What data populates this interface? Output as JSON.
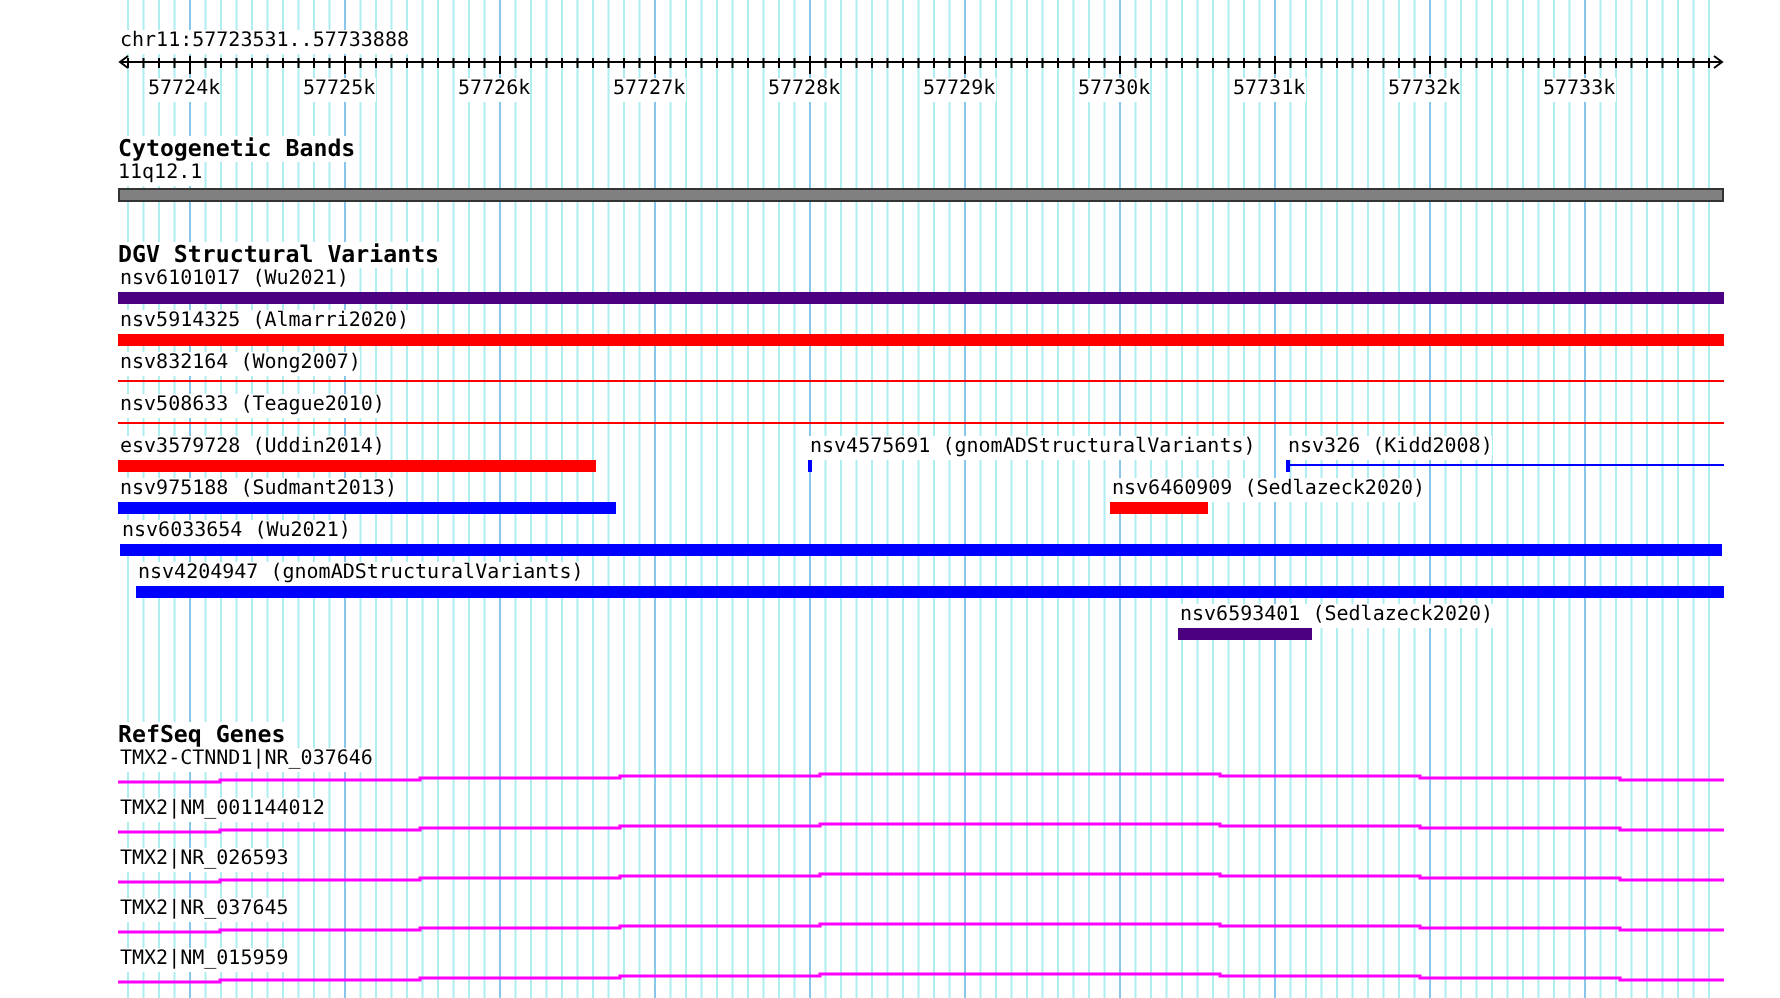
{
  "location": "chr11:57723531..57733888",
  "ruler": {
    "ticks": [
      "57724k",
      "57725k",
      "57726k",
      "57727k",
      "57728k",
      "57729k",
      "57730k",
      "57731k",
      "57732k",
      "57733k"
    ]
  },
  "tracks": [
    {
      "title": "Cytogenetic Bands",
      "kind": "bands",
      "rows": [
        {
          "features": [
            {
              "label": "11q12.1",
              "kind": "band"
            }
          ]
        }
      ]
    },
    {
      "title": "DGV Structural Variants",
      "kind": "variants",
      "rows": [
        {
          "features": [
            {
              "label": "nsv6101017 (Wu2021)",
              "kind": "bar",
              "color": "#4b0082"
            }
          ]
        },
        {
          "features": [
            {
              "label": "nsv5914325 (Almarri2020)",
              "kind": "bar",
              "color": "#ff0000"
            }
          ]
        },
        {
          "features": [
            {
              "label": "nsv832164 (Wong2007)",
              "kind": "line",
              "color": "#ff0000"
            }
          ]
        },
        {
          "features": [
            {
              "label": "nsv508633 (Teague2010)",
              "kind": "line",
              "color": "#ff0000"
            }
          ]
        },
        {
          "features": [
            {
              "label": "esv3579728 (Uddin2014)",
              "kind": "bar",
              "color": "#ff0000"
            },
            {
              "label": "nsv4575691 (gnomADStructuralVariants)",
              "kind": "bar",
              "color": "#0000ff"
            },
            {
              "label": "nsv326 (Kidd2008)",
              "kind": "capped",
              "color": "#0000ff"
            }
          ]
        },
        {
          "features": [
            {
              "label": "nsv975188 (Sudmant2013)",
              "kind": "bar",
              "color": "#0000ff"
            },
            {
              "label": "nsv6460909 (Sedlazeck2020)",
              "kind": "bar",
              "color": "#ff0000"
            }
          ]
        },
        {
          "features": [
            {
              "label": "nsv6033654 (Wu2021)",
              "kind": "bar",
              "color": "#0000ff"
            }
          ]
        },
        {
          "features": [
            {
              "label": "nsv4204947 (gnomADStructuralVariants)",
              "kind": "bar",
              "color": "#0000ff"
            }
          ]
        },
        {
          "features": [
            {
              "label": "nsv6593401 (Sedlazeck2020)",
              "kind": "bar",
              "color": "#4b0082"
            }
          ]
        }
      ]
    },
    {
      "title": "RefSeq Genes",
      "kind": "genes",
      "rows": [
        {
          "features": [
            {
              "label": "TMX2-CTNND1|NR_037646",
              "kind": "gene"
            }
          ]
        },
        {
          "features": [
            {
              "label": "TMX2|NM_001144012",
              "kind": "gene"
            }
          ]
        },
        {
          "features": [
            {
              "label": "TMX2|NR_026593",
              "kind": "gene"
            }
          ]
        },
        {
          "features": [
            {
              "label": "TMX2|NR_037645",
              "kind": "gene"
            }
          ]
        },
        {
          "features": [
            {
              "label": "TMX2|NM_015959",
              "kind": "gene"
            }
          ]
        }
      ]
    }
  ]
}
